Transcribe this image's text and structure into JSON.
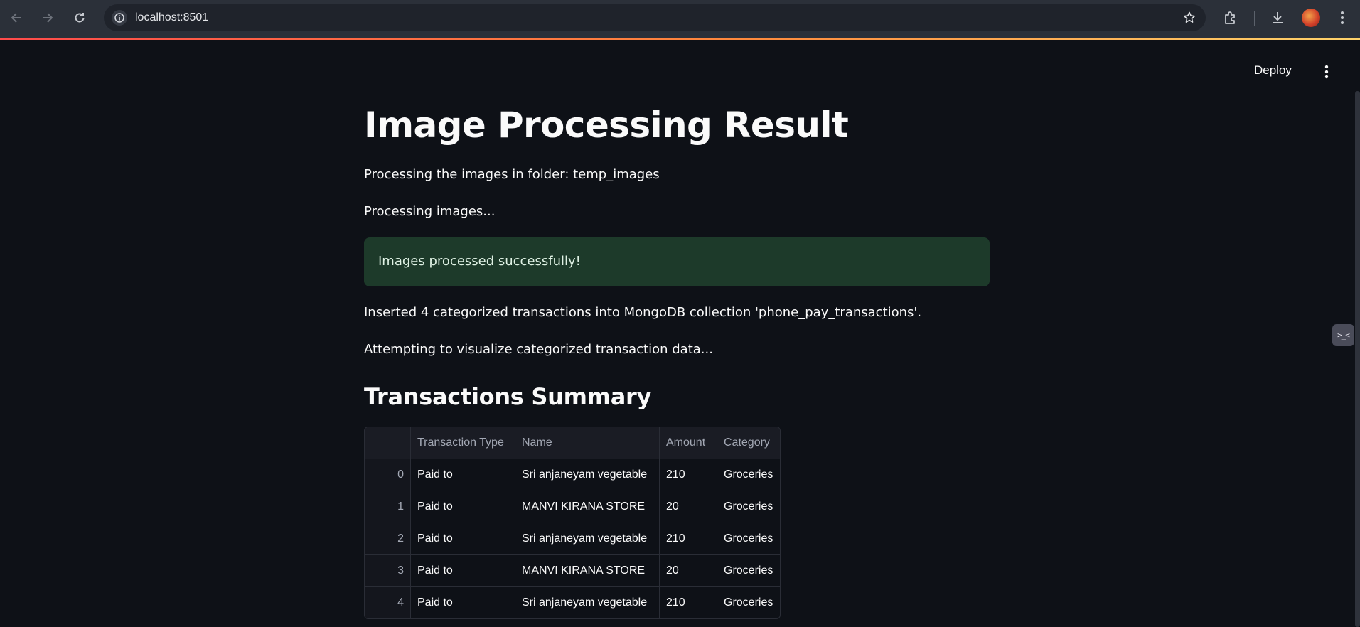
{
  "browser": {
    "url": "localhost:8501",
    "icons": [
      "back-icon",
      "forward-icon",
      "reload-icon",
      "info-icon",
      "star-icon",
      "extensions-icon",
      "download-icon",
      "profile-avatar",
      "more-vert-icon"
    ]
  },
  "app_header": {
    "deploy_label": "Deploy",
    "menu_icon": "more-vert-icon"
  },
  "main": {
    "title": "Image Processing Result",
    "folder_text": "Processing the images in folder: temp_images",
    "processing_text": "Processing images...",
    "success_message": "Images processed successfully!",
    "inserted_text": "Inserted 4 categorized transactions into MongoDB collection 'phone_pay_transactions'.",
    "visualize_text": "Attempting to visualize categorized transaction data...",
    "summary_title": "Transactions Summary"
  },
  "table": {
    "columns": [
      "",
      "Transaction Type",
      "Name",
      "Amount",
      "Category"
    ],
    "rows": [
      [
        "0",
        "Paid to",
        "Sri anjaneyam vegetable",
        "210",
        "Groceries"
      ],
      [
        "1",
        "Paid to",
        "MANVI KIRANA STORE",
        "20",
        "Groceries"
      ],
      [
        "2",
        "Paid to",
        "Sri anjaneyam vegetable",
        "210",
        "Groceries"
      ],
      [
        "3",
        "Paid to",
        "MANVI KIRANA STORE",
        "20",
        "Groceries"
      ],
      [
        "4",
        "Paid to",
        "Sri anjaneyam vegetable",
        "210",
        "Groceries"
      ]
    ]
  },
  "colors": {
    "background": "#0e1117",
    "success_bg": "#1d3a2a",
    "accent": "#ff4b4b"
  }
}
